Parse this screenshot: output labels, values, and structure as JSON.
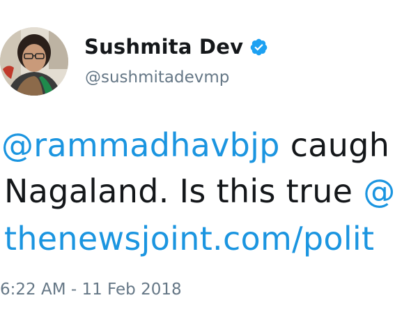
{
  "author": {
    "display_name": "Sushmita Dev",
    "handle": "@sushmitadevmp",
    "verified": true
  },
  "tweet": {
    "line1": {
      "mention": "@rammadhavbjp",
      "text": " caugh"
    },
    "line2": {
      "text": "Nagaland. Is this true ",
      "mention": "@"
    },
    "line3": {
      "link": "thenewsjoint.com/polit"
    },
    "timestamp": "6:22 AM - 11 Feb 2018"
  },
  "colors": {
    "link": "#1b95e0",
    "verified_badge": "#1da1f2",
    "secondary_text": "#657786",
    "primary_text": "#14171a"
  },
  "icons": {
    "verified": "verified-badge-icon"
  }
}
